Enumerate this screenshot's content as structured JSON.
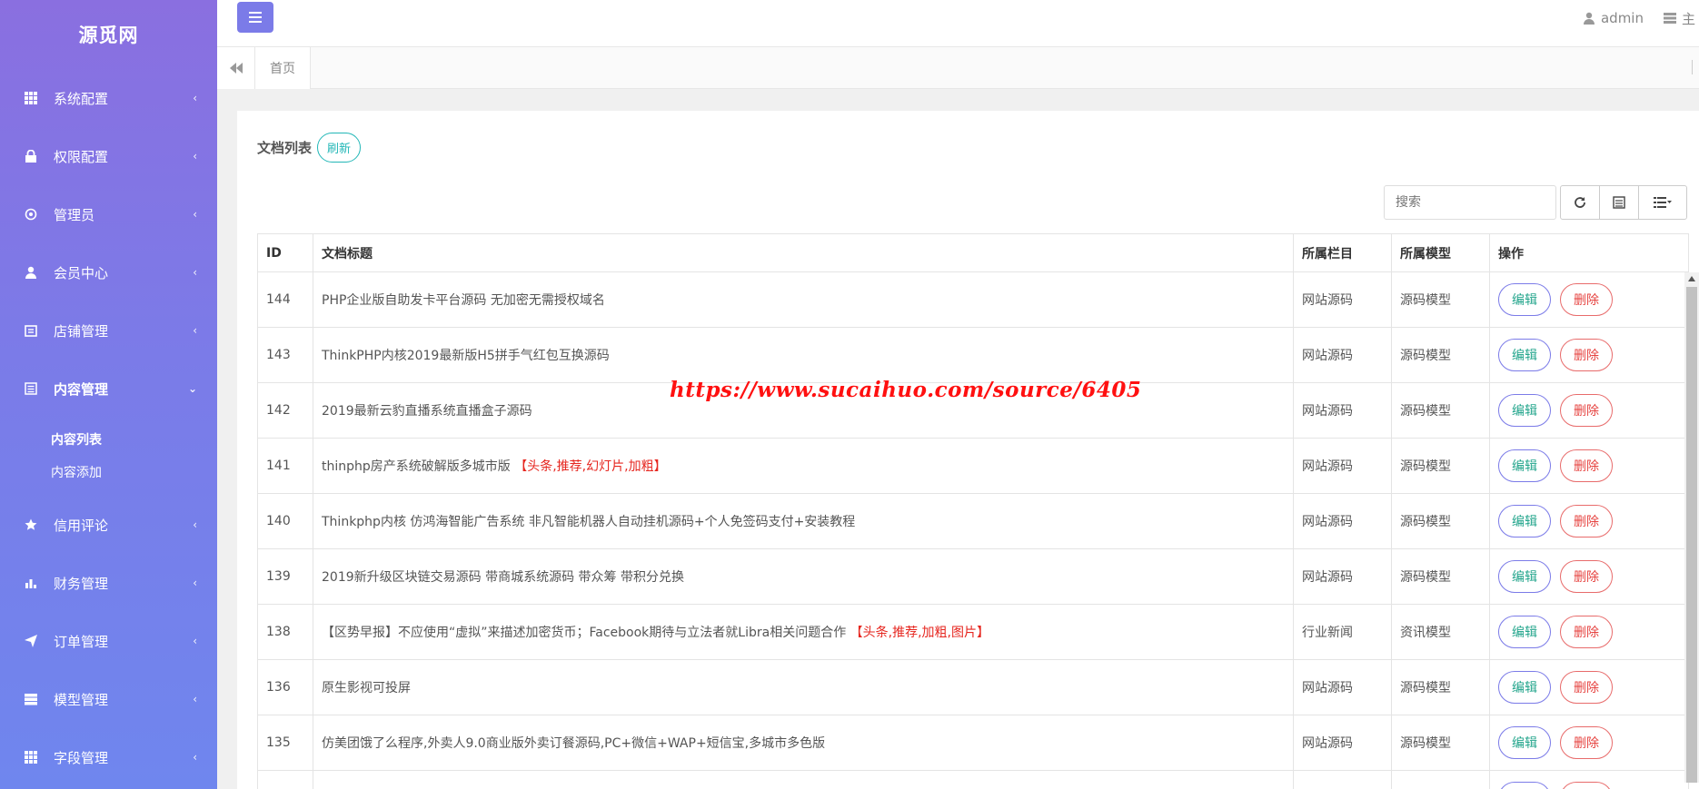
{
  "brand": "源觅网",
  "sidebar": {
    "items": [
      {
        "label": "系统配置",
        "icon": "grid-icon"
      },
      {
        "label": "权限配置",
        "icon": "lock-icon"
      },
      {
        "label": "管理员",
        "icon": "target-icon"
      },
      {
        "label": "会员中心",
        "icon": "user-icon"
      },
      {
        "label": "店铺管理",
        "icon": "store-icon"
      },
      {
        "label": "内容管理",
        "icon": "list-icon",
        "active": true,
        "sub": [
          {
            "label": "内容列表",
            "active": true
          },
          {
            "label": "内容添加"
          }
        ]
      },
      {
        "label": "信用评论",
        "icon": "star-icon"
      },
      {
        "label": "财务管理",
        "icon": "bar-chart-icon"
      },
      {
        "label": "订单管理",
        "icon": "send-icon"
      },
      {
        "label": "模型管理",
        "icon": "server-icon"
      },
      {
        "label": "字段管理",
        "icon": "grid-icon"
      }
    ]
  },
  "topbar": {
    "user": "admin",
    "extra": "主"
  },
  "tabs": {
    "home": "首页"
  },
  "panel": {
    "title": "文档列表",
    "refresh": "刷新",
    "search_placeholder": "搜索"
  },
  "table": {
    "headers": [
      "ID",
      "文档标题",
      "所属栏目",
      "所属模型",
      "操作"
    ],
    "rows": [
      {
        "id": "144",
        "title": "PHP企业版自助发卡平台源码 无加密无需授权域名",
        "flags": "",
        "column": "网站源码",
        "model": "源码模型"
      },
      {
        "id": "143",
        "title": "ThinkPHP内核2019最新版H5拼手气红包互换源码",
        "flags": "",
        "column": "网站源码",
        "model": "源码模型"
      },
      {
        "id": "142",
        "title": "2019最新云豹直播系统直播盒子源码",
        "flags": "",
        "column": "网站源码",
        "model": "源码模型"
      },
      {
        "id": "141",
        "title": "thinphp房产系统破解版多城市版",
        "flags": "【头条,推荐,幻灯片,加粗】",
        "column": "网站源码",
        "model": "源码模型"
      },
      {
        "id": "140",
        "title": "Thinkphp内核 仿鸿海智能广告系统 非凡智能机器人自动挂机源码+个人免签码支付+安装教程",
        "flags": "",
        "column": "网站源码",
        "model": "源码模型"
      },
      {
        "id": "139",
        "title": "2019新升级区块链交易源码 带商城系统源码 带众筹 带积分兑换",
        "flags": "",
        "column": "网站源码",
        "model": "源码模型"
      },
      {
        "id": "138",
        "title": "【区势早报】不应使用“虚拟”来描述加密货币；Facebook期待与立法者就Libra相关问题合作",
        "flags": "【头条,推荐,加粗,图片】",
        "column": "行业新闻",
        "model": "资讯模型"
      },
      {
        "id": "136",
        "title": "原生影视可投屏",
        "flags": "",
        "column": "网站源码",
        "model": "源码模型"
      },
      {
        "id": "135",
        "title": "仿美团饿了么程序,外卖人9.0商业版外卖订餐源码,PC+微信+WAP+短信宝,多城市多色版",
        "flags": "",
        "column": "网站源码",
        "model": "源码模型"
      },
      {
        "id": "",
        "title": "",
        "flags": "",
        "column": "",
        "model": ""
      }
    ],
    "edit_label": "编辑",
    "delete_label": "删除"
  },
  "watermark": "https://www.sucaihuo.com/source/6405"
}
